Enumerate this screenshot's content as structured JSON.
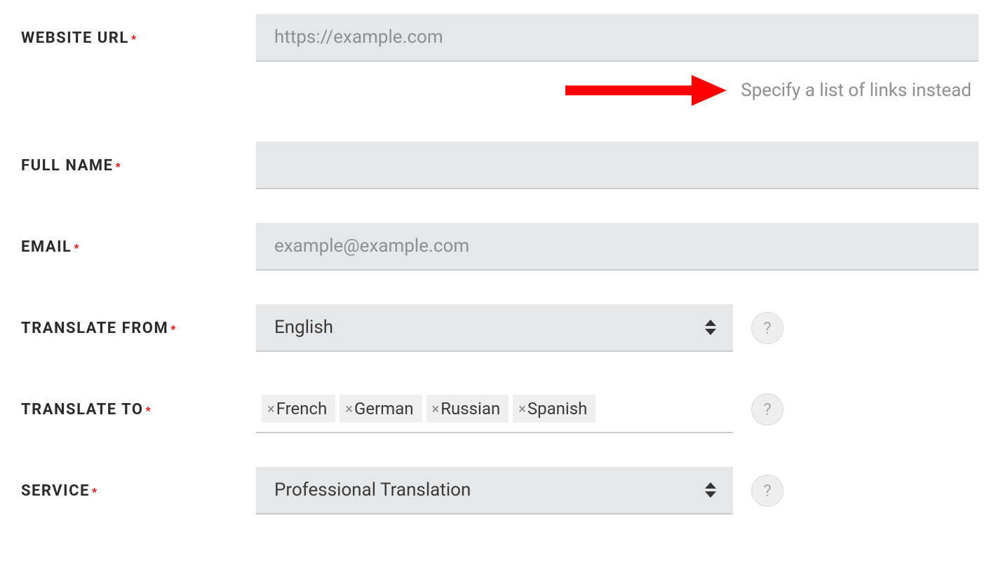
{
  "fields": {
    "website_url": {
      "label": "WEBSITE URL",
      "placeholder": "https://example.com",
      "value": "",
      "required_marker": "*"
    },
    "specify_link": "Specify a list of links instead",
    "full_name": {
      "label": "FULL NAME",
      "placeholder": "",
      "value": "",
      "required_marker": "*"
    },
    "email": {
      "label": "EMAIL",
      "placeholder": "example@example.com",
      "value": "",
      "required_marker": "*"
    },
    "translate_from": {
      "label": "TRANSLATE FROM",
      "value": "English",
      "required_marker": "*",
      "help": "?"
    },
    "translate_to": {
      "label": "TRANSLATE TO",
      "tags": [
        "French",
        "German",
        "Russian",
        "Spanish"
      ],
      "required_marker": "*",
      "help": "?"
    },
    "service": {
      "label": "SERVICE",
      "value": "Professional Translation",
      "required_marker": "*",
      "help": "?"
    }
  },
  "colors": {
    "input_bg": "#e6e7e8",
    "required": "#e60000",
    "arrow": "#ff0000"
  }
}
